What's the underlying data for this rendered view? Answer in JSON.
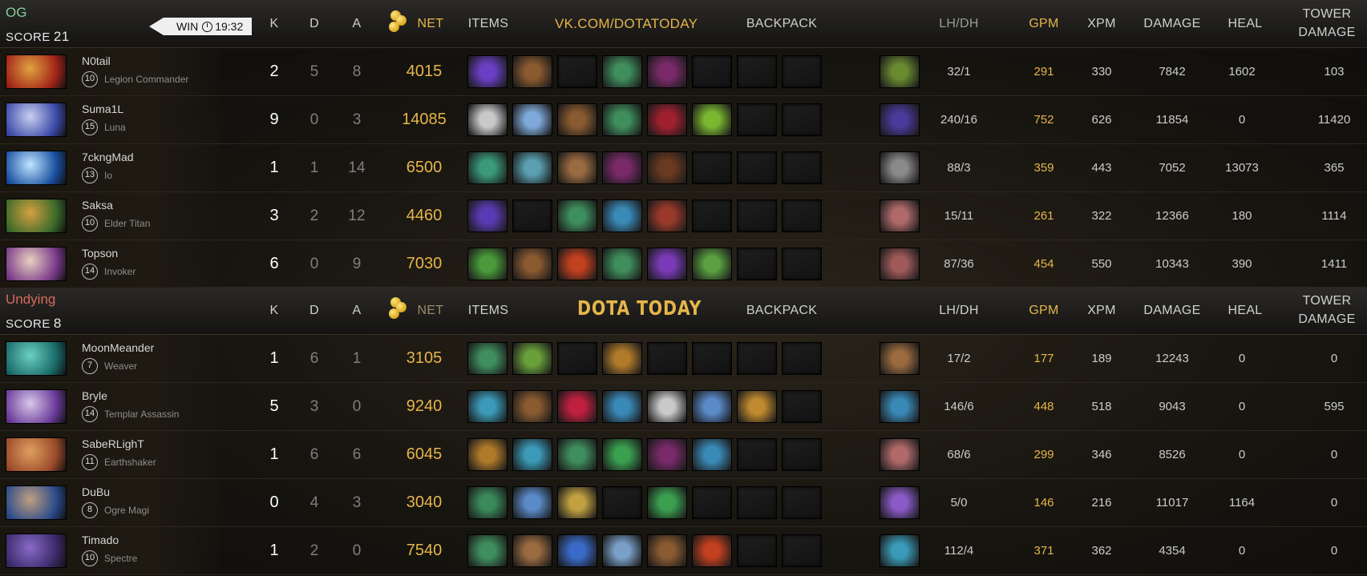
{
  "colors": {
    "gold": "#e6b54a",
    "radiant": "#7fcf9a",
    "dire": "#d46a5a"
  },
  "columns": {
    "k": "K",
    "d": "D",
    "a": "A",
    "net": "NET",
    "items": "ITEMS",
    "backpack": "BACKPACK",
    "lhdh": "LH/DH",
    "gpm": "GPM",
    "xpm": "XPM",
    "damage": "DAMAGE",
    "heal": "HEAL",
    "tower1": "TOWER",
    "tower2": "DAMAGE"
  },
  "watermark_top": "VK.COM/DOTATODAY",
  "watermark_mid": "DOTA TODAY",
  "team1": {
    "name": "OG",
    "score_label": "SCORE",
    "score": "21",
    "result": "WIN",
    "duration": "19:32",
    "players": [
      {
        "name": "N0tail",
        "level": "10",
        "hero": "Legion Commander",
        "k": "2",
        "d": "5",
        "a": "8",
        "net": "4015",
        "lhdh": "32/1",
        "gpm": "291",
        "xpm": "330",
        "damage": "7842",
        "heal": "1602",
        "tower": "103",
        "portrait": [
          "#a12318",
          "#e0a340"
        ],
        "items": [
          "#6a3fc4",
          "#8a5a30",
          "",
          "#3f8f5e",
          "#7a2a6a",
          "",
          "",
          ""
        ],
        "neutral": "#6a8a30"
      },
      {
        "name": "Suma1L",
        "level": "15",
        "hero": "Luna",
        "k": "9",
        "d": "0",
        "a": "3",
        "net": "14085",
        "lhdh": "240/16",
        "gpm": "752",
        "xpm": "626",
        "damage": "11854",
        "heal": "0",
        "tower": "11420",
        "portrait": [
          "#3c4aa8",
          "#c8d0ef"
        ],
        "items": [
          "#c9c9c9",
          "#7ea9d8",
          "#8a5a30",
          "#3f8f5e",
          "#a02030",
          "#7ab830",
          "",
          ""
        ],
        "neutral": "#4a3a9a"
      },
      {
        "name": "7ckngMad",
        "level": "13",
        "hero": "Io",
        "k": "1",
        "d": "1",
        "a": "14",
        "net": "6500",
        "lhdh": "88/3",
        "gpm": "359",
        "xpm": "443",
        "damage": "7052",
        "heal": "13073",
        "tower": "365",
        "portrait": [
          "#1a4fa0",
          "#bfe6ff"
        ],
        "items": [
          "#3a9a7a",
          "#5aa0b0",
          "#9a6a40",
          "#7a2a6a",
          "#6a3a20",
          "",
          "",
          ""
        ],
        "neutral": "#8a8a8a"
      },
      {
        "name": "Saksa",
        "level": "10",
        "hero": "Elder Titan",
        "k": "3",
        "d": "2",
        "a": "12",
        "net": "4460",
        "lhdh": "15/11",
        "gpm": "261",
        "xpm": "322",
        "damage": "12366",
        "heal": "180",
        "tower": "1114",
        "portrait": [
          "#3a6a2a",
          "#d4a040"
        ],
        "items": [
          "#5a3ab4",
          "",
          "#3f8f5e",
          "#3a8ab8",
          "#9a3a2a",
          "",
          "",
          ""
        ],
        "neutral": "#b06a6a"
      },
      {
        "name": "Topson",
        "level": "14",
        "hero": "Invoker",
        "k": "6",
        "d": "0",
        "a": "9",
        "net": "7030",
        "lhdh": "87/36",
        "gpm": "454",
        "xpm": "550",
        "damage": "10343",
        "heal": "390",
        "tower": "1411",
        "portrait": [
          "#7a3a8a",
          "#e8d0c0"
        ],
        "items": [
          "#4a9a3a",
          "#8a5a30",
          "#c04020",
          "#3f8f5e",
          "#7a3ab8",
          "#5aa040",
          "",
          ""
        ],
        "neutral": "#a05a5a"
      }
    ]
  },
  "team2": {
    "name": "Undying",
    "score_label": "SCORE",
    "score": "8",
    "players": [
      {
        "name": "MoonMeander",
        "level": "7",
        "hero": "Weaver",
        "k": "1",
        "d": "6",
        "a": "1",
        "net": "3105",
        "lhdh": "17/2",
        "gpm": "177",
        "xpm": "189",
        "damage": "12243",
        "heal": "0",
        "tower": "0",
        "portrait": [
          "#1a6a6a",
          "#6ad0c0"
        ],
        "items": [
          "#3f8f5e",
          "#6aa03a",
          "",
          "#b07a2a",
          "",
          "",
          "",
          ""
        ],
        "neutral": "#9a6a40"
      },
      {
        "name": "Bryle",
        "level": "14",
        "hero": "Templar Assassin",
        "k": "5",
        "d": "3",
        "a": "0",
        "net": "9240",
        "lhdh": "146/6",
        "gpm": "448",
        "xpm": "518",
        "damage": "9043",
        "heal": "0",
        "tower": "595",
        "portrait": [
          "#6a3a9a",
          "#d8c8e8"
        ],
        "items": [
          "#3a9ab8",
          "#8a5a30",
          "#c02040",
          "#3a8ab8",
          "#c9c9c9",
          "#5a8ac8",
          "#c08a30",
          ""
        ],
        "neutral": "#3a8ab8"
      },
      {
        "name": "SabeRLighT",
        "level": "11",
        "hero": "Earthshaker",
        "k": "1",
        "d": "6",
        "a": "6",
        "net": "6045",
        "lhdh": "68/6",
        "gpm": "299",
        "xpm": "346",
        "damage": "8526",
        "heal": "0",
        "tower": "0",
        "portrait": [
          "#9a4a2a",
          "#e0a060"
        ],
        "items": [
          "#b07a2a",
          "#3a9ab8",
          "#3f8f5e",
          "#3aa050",
          "#7a2a6a",
          "#3a8ab8",
          "",
          ""
        ],
        "neutral": "#b06a6a"
      },
      {
        "name": "DuBu",
        "level": "8",
        "hero": "Ogre Magi",
        "k": "0",
        "d": "4",
        "a": "3",
        "net": "3040",
        "lhdh": "5/0",
        "gpm": "146",
        "xpm": "216",
        "damage": "11017",
        "heal": "1164",
        "tower": "0",
        "portrait": [
          "#2a4a8a",
          "#c0a080"
        ],
        "items": [
          "#3a8a5a",
          "#5a8ac8",
          "#c0a040",
          "",
          "#3aa050",
          "",
          "",
          ""
        ],
        "neutral": "#8a5ac8"
      },
      {
        "name": "Timado",
        "level": "10",
        "hero": "Spectre",
        "k": "1",
        "d": "2",
        "a": "0",
        "net": "7540",
        "lhdh": "112/4",
        "gpm": "371",
        "xpm": "362",
        "damage": "4354",
        "heal": "0",
        "tower": "0",
        "portrait": [
          "#3a2a6a",
          "#8a6ac8"
        ],
        "items": [
          "#3f8f5e",
          "#9a6a40",
          "#3a6ac8",
          "#7aa0c8",
          "#8a5a30",
          "#c04020",
          "",
          ""
        ],
        "neutral": "#3a9ab8"
      }
    ]
  }
}
